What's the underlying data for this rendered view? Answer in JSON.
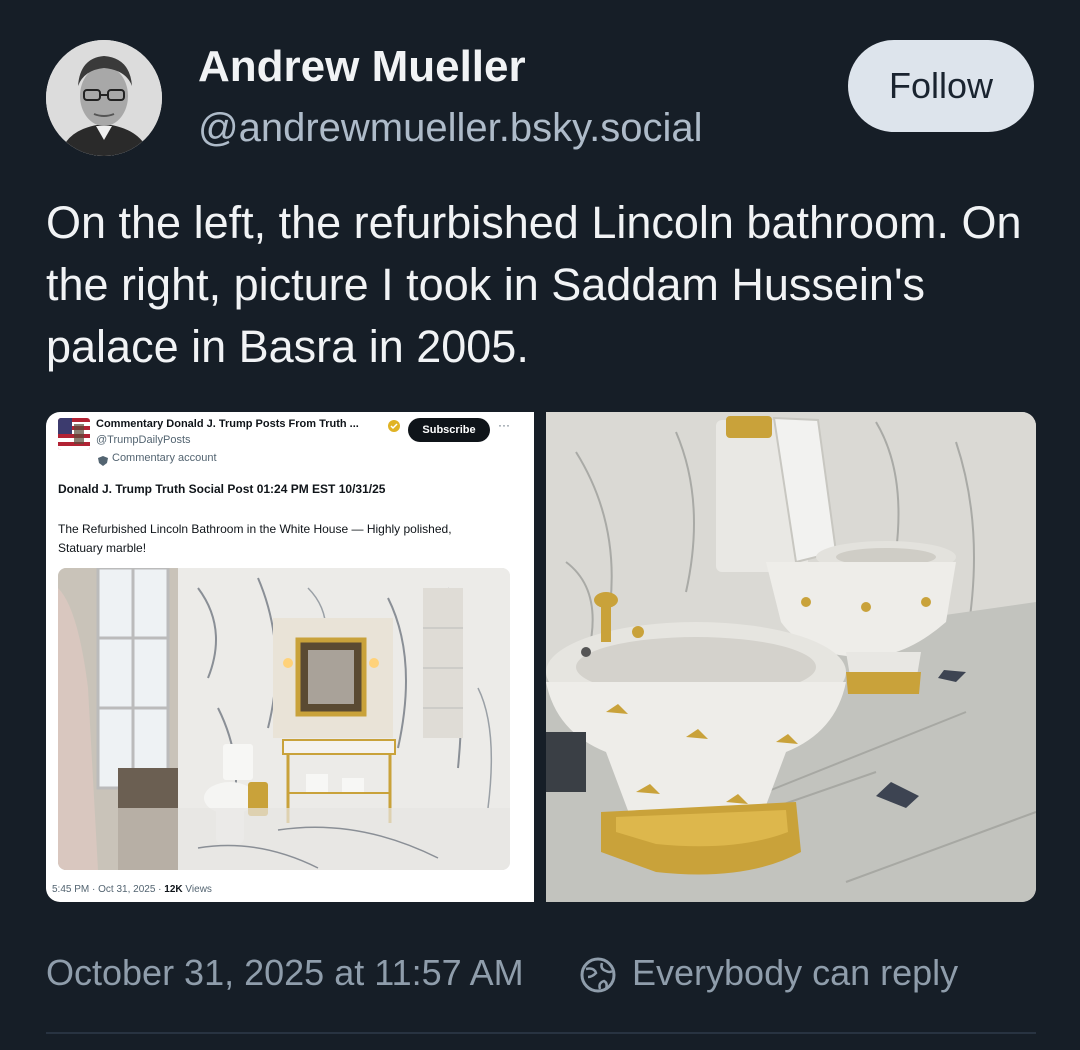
{
  "author": {
    "name": "Andrew Mueller",
    "handle": "@andrewmueller.bsky.social",
    "follow_label": "Follow"
  },
  "post": {
    "text": "On the left, the refurbished Lincoln bathroom. On the right, picture I took in Saddam Hussein's palace in Basra in 2005.",
    "timestamp": "October 31, 2025 at 11:57 AM",
    "reply_setting": "Everybody can reply"
  },
  "embedded_screenshot": {
    "account_name": "Commentary Donald J. Trump Posts From Truth ...",
    "handle": "@TrumpDailyPosts",
    "account_type": "Commentary account",
    "subscribe_label": "Subscribe",
    "more_label": "···",
    "title": "Donald J. Trump Truth Social Post 01:24 PM EST 10/31/25",
    "description": "The Refurbished Lincoln Bathroom in the White House — Highly polished, Statuary marble!",
    "footer_time": "5:45 PM · Oct 31, 2025 · ",
    "footer_views": "12K",
    "footer_views_label": " Views"
  },
  "icons": {
    "reply_icon": "globe-no-reply-icon",
    "verified_icon": "verified-badge-icon",
    "commentary_icon": "shield-icon"
  },
  "colors": {
    "background": "#161e27",
    "follow_bg": "#dde4ec",
    "muted_text": "#8f9dab",
    "gold": "#c9a23a"
  }
}
